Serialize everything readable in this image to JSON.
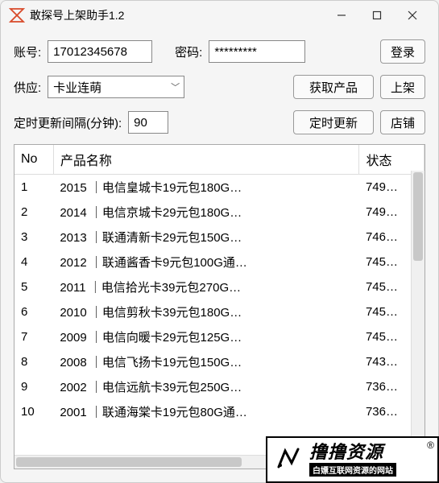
{
  "window": {
    "title": "敢探号上架助手1.2"
  },
  "form": {
    "account_label": "账号:",
    "account_value": "17012345678",
    "password_label": "密码:",
    "password_value": "*********",
    "login_btn": "登录",
    "supplier_label": "供应:",
    "supplier_value": "卡业连萌",
    "fetch_btn": "获取产品",
    "publish_btn": "上架",
    "interval_label": "定时更新间隔(分钟):",
    "interval_value": "90",
    "timer_btn": "定时更新",
    "shop_btn": "店铺"
  },
  "table": {
    "headers": {
      "no": "No",
      "name": "产品名称",
      "status": "状态"
    },
    "rows": [
      {
        "no": "1",
        "name": "2015 ｜电信皇城卡19元包180G…",
        "status": "749…"
      },
      {
        "no": "2",
        "name": "2014 ｜电信京城卡29元包180G…",
        "status": "749…"
      },
      {
        "no": "3",
        "name": "2013 ｜联通清新卡29元包150G…",
        "status": "746…"
      },
      {
        "no": "4",
        "name": "2012 ｜联通酱香卡9元包100G通…",
        "status": "745…"
      },
      {
        "no": "5",
        "name": "2011 ｜电信拾光卡39元包270G…",
        "status": "745…"
      },
      {
        "no": "6",
        "name": "2010 ｜电信剪秋卡39元包180G…",
        "status": "745…"
      },
      {
        "no": "7",
        "name": "2009 ｜电信向暖卡29元包125G…",
        "status": "745…"
      },
      {
        "no": "8",
        "name": "2008 ｜电信飞扬卡19元包150G…",
        "status": "743…"
      },
      {
        "no": "9",
        "name": "2002 ｜电信远航卡39元包250G…",
        "status": "736…"
      },
      {
        "no": "10",
        "name": "2001 ｜联通海棠卡19元包80G通…",
        "status": "736…"
      }
    ]
  },
  "watermark": {
    "main": "撸撸资源",
    "sub": "白嫖互联网资源的网站",
    "reg": "®"
  }
}
